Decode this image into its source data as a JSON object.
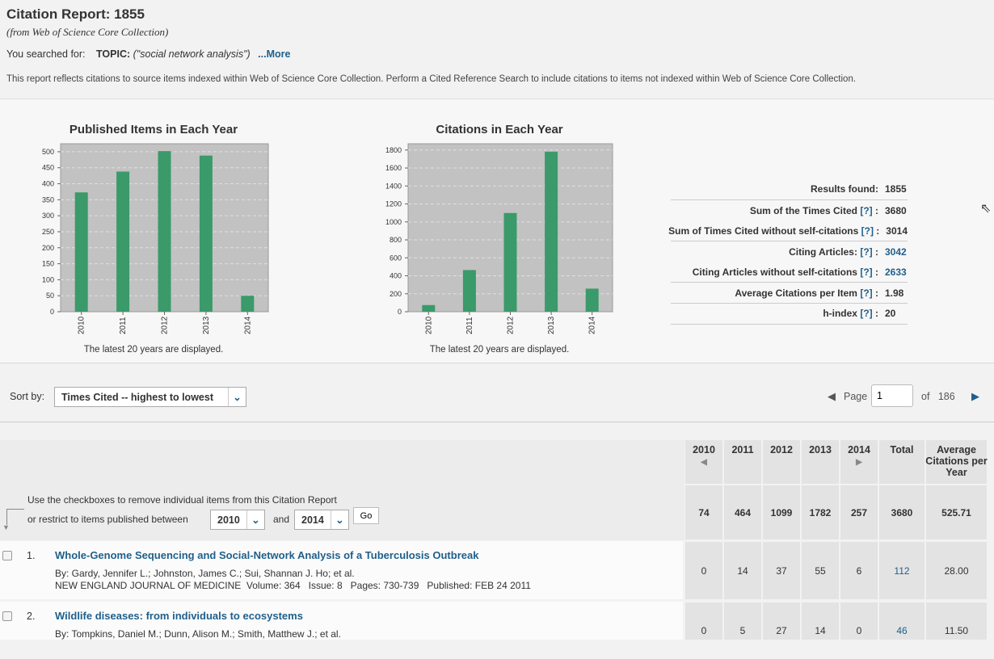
{
  "header": {
    "title": "Citation Report: 1855",
    "subtitle": "(from Web of Science Core Collection)",
    "searched_label": "You searched for:",
    "topic_label": "TOPIC:",
    "topic_value": "(\"social network analysis\")",
    "more_link": "...More",
    "note": "This report reflects citations to source items indexed within Web of Science Core Collection. Perform a Cited Reference Search to include citations to items not indexed within Web of Science Core Collection."
  },
  "chart_data": [
    {
      "type": "bar",
      "title": "Published Items in Each Year",
      "categories": [
        "2010",
        "2011",
        "2012",
        "2013",
        "2014"
      ],
      "values": [
        373,
        438,
        502,
        488,
        50
      ],
      "ylim": [
        0,
        525
      ],
      "yticks": [
        0,
        50,
        100,
        150,
        200,
        250,
        300,
        350,
        400,
        450,
        500
      ],
      "grid": true,
      "color": "#3a9a6a",
      "note": "The latest 20 years are displayed."
    },
    {
      "type": "bar",
      "title": "Citations in Each Year",
      "categories": [
        "2010",
        "2011",
        "2012",
        "2013",
        "2014"
      ],
      "values": [
        74,
        464,
        1099,
        1782,
        257
      ],
      "ylim": [
        0,
        1870
      ],
      "yticks": [
        0,
        200,
        400,
        600,
        800,
        1000,
        1200,
        1400,
        1600,
        1800
      ],
      "grid": true,
      "color": "#3a9a6a",
      "note": "The latest 20 years are displayed."
    }
  ],
  "stats": [
    {
      "label": "Results found:",
      "help": "",
      "value": "1855",
      "link": false
    },
    {
      "label": "Sum of the Times Cited",
      "help": "[?]",
      "value": "3680",
      "link": false
    },
    {
      "label": "Sum of Times Cited without self-citations",
      "help": "[?]",
      "value": "3014",
      "link": false
    },
    {
      "label": "Citing Articles:",
      "help": "[?]",
      "value": "3042",
      "link": true
    },
    {
      "label": "Citing Articles without self-citations",
      "help": "[?]",
      "value": "2633",
      "link": true
    },
    {
      "label": "Average Citations per Item",
      "help": "[?]",
      "value": "1.98",
      "link": false
    },
    {
      "label": "h-index",
      "help": "[?]",
      "value": "20",
      "link": false
    }
  ],
  "sort": {
    "label": "Sort by:",
    "value": "Times Cited -- highest to lowest"
  },
  "pager": {
    "page_label": "Page",
    "page_value": "1",
    "of_label": "of",
    "total_pages": "186"
  },
  "filter": {
    "line1": "Use the checkboxes to remove individual items from this Citation Report",
    "line2": "or restrict to items published between",
    "from": "2010",
    "and_label": "and",
    "to": "2014",
    "go": "Go"
  },
  "table": {
    "columns": [
      "2010",
      "2011",
      "2012",
      "2013",
      "2014",
      "Total",
      "Average Citations per Year"
    ],
    "totals": [
      "74",
      "464",
      "1099",
      "1782",
      "257",
      "3680",
      "525.71"
    ],
    "rows": [
      {
        "num": "1.",
        "title": "Whole-Genome Sequencing and Social-Network Analysis of a Tuberculosis Outbreak",
        "authors": "By: Gardy, Jennifer L.; Johnston, James C.; Sui, Shannan J. Ho; et al.",
        "source": "NEW ENGLAND JOURNAL OF MEDICINE  Volume: 364   Issue: 8   Pages: 730-739   Published: FEB 24 2011",
        "values": [
          "0",
          "14",
          "37",
          "55",
          "6",
          "112",
          "28.00"
        ]
      },
      {
        "num": "2.",
        "title": "Wildlife diseases: from individuals to ecosystems",
        "authors": "By: Tompkins, Daniel M.; Dunn, Alison M.; Smith, Matthew J.; et al.",
        "source": "",
        "values": [
          "0",
          "5",
          "27",
          "14",
          "0",
          "46",
          "11.50"
        ]
      }
    ]
  }
}
